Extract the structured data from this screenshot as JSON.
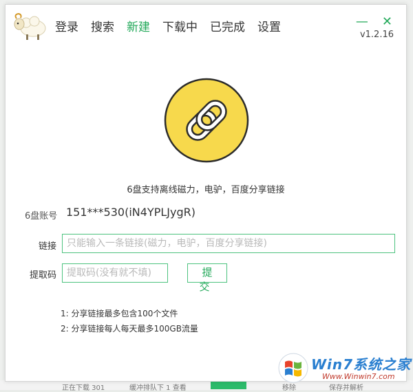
{
  "nav": {
    "items": [
      {
        "label": "登录",
        "active": false
      },
      {
        "label": "搜索",
        "active": false
      },
      {
        "label": "新建",
        "active": true
      },
      {
        "label": "下载中",
        "active": false
      },
      {
        "label": "已完成",
        "active": false
      },
      {
        "label": "设置",
        "active": false
      }
    ]
  },
  "window": {
    "minimize": "—",
    "close": "✕",
    "version": "v1.2.16"
  },
  "colors": {
    "accent": "#23a95a",
    "hero_circle": "#f7d94c",
    "input_border": "#4cc27e"
  },
  "main": {
    "support_text": "6盘支持离线磁力，电驴，百度分享链接",
    "account_label": "6盘账号",
    "account_value": "151***530(iN4YPLJygR)",
    "link_label": "链接",
    "link_placeholder": "只能输入一条链接(磁力，电驴，百度分享链接)",
    "code_label": "提取码",
    "code_placeholder": "提取码(没有就不填)",
    "submit_label": "提交",
    "notes": [
      "1:  分享链接最多包含100个文件",
      "2:  分享链接每人每天最多100GB流量"
    ]
  },
  "background": {
    "bottom_items": [
      "正在下载 301",
      "缓冲排队下 1  查看",
      "",
      "移除",
      "保存并解析"
    ]
  },
  "watermark": {
    "text": "Win7系统之家",
    "url": "Www.Winwin7.com"
  },
  "icons": {
    "logo": "sheep-icon",
    "hero": "link-chain-icon"
  }
}
